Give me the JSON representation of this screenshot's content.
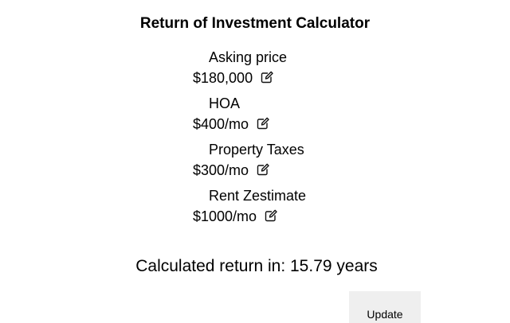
{
  "title": "Return of Investment Calculator",
  "fields": [
    {
      "label": "Asking price",
      "value": "$180,000",
      "icon": "edit-icon"
    },
    {
      "label": "HOA",
      "value": "$400/mo",
      "icon": "edit-icon"
    },
    {
      "label": "Property Taxes",
      "value": "$300/mo",
      "icon": "edit-icon"
    },
    {
      "label": "Rent Zestimate",
      "value": "$1000/mo",
      "icon": "edit-icon"
    }
  ],
  "result": {
    "text": "Calculated return in: 15.79 years"
  },
  "update_button": {
    "label": "Update"
  }
}
